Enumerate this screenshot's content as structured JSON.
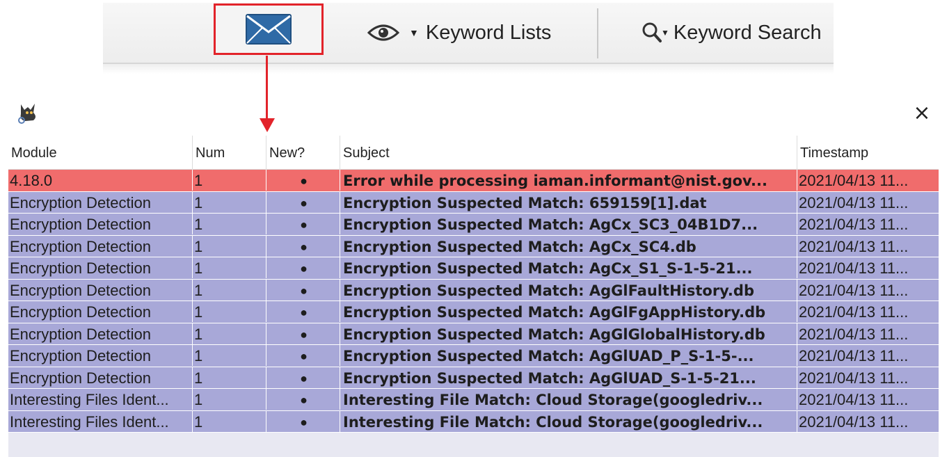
{
  "toolbar": {
    "mail_icon": "envelope-icon",
    "keyword_lists_label": "Keyword Lists",
    "keyword_lists_icon": "eye-icon",
    "keyword_search_label": "Keyword Search",
    "keyword_search_icon": "magnifier-icon",
    "highlight_color": "#e2232a"
  },
  "panel": {
    "app_icon": "autopsy-dog-icon",
    "close_label": "×"
  },
  "table": {
    "headers": {
      "module": "Module",
      "num": "Num",
      "new": "New?",
      "subject": "Subject",
      "timestamp": "Timestamp"
    },
    "rows": [
      {
        "module": "4.18.0",
        "num": "1",
        "new": "●",
        "subject": "Error while processing iaman.informant@nist.gov...",
        "timestamp": "2021/04/13 11...",
        "status": "error"
      },
      {
        "module": "Encryption Detection",
        "num": "1",
        "new": "●",
        "subject": "Encryption Suspected Match: 659159[1].dat",
        "timestamp": "2021/04/13 11...",
        "status": "normal"
      },
      {
        "module": "Encryption Detection",
        "num": "1",
        "new": "●",
        "subject": "Encryption Suspected Match: AgCx_SC3_04B1D7...",
        "timestamp": "2021/04/13 11...",
        "status": "normal"
      },
      {
        "module": "Encryption Detection",
        "num": "1",
        "new": "●",
        "subject": "Encryption Suspected Match: AgCx_SC4.db",
        "timestamp": "2021/04/13 11...",
        "status": "normal"
      },
      {
        "module": "Encryption Detection",
        "num": "1",
        "new": "●",
        "subject": "Encryption Suspected Match: AgCx_S1_S-1-5-21...",
        "timestamp": "2021/04/13 11...",
        "status": "normal"
      },
      {
        "module": "Encryption Detection",
        "num": "1",
        "new": "●",
        "subject": "Encryption Suspected Match: AgGlFaultHistory.db",
        "timestamp": "2021/04/13 11...",
        "status": "normal"
      },
      {
        "module": "Encryption Detection",
        "num": "1",
        "new": "●",
        "subject": "Encryption Suspected Match: AgGlFgAppHistory.db",
        "timestamp": "2021/04/13 11...",
        "status": "normal"
      },
      {
        "module": "Encryption Detection",
        "num": "1",
        "new": "●",
        "subject": "Encryption Suspected Match: AgGlGlobalHistory.db",
        "timestamp": "2021/04/13 11...",
        "status": "normal"
      },
      {
        "module": "Encryption Detection",
        "num": "1",
        "new": "●",
        "subject": "Encryption Suspected Match: AgGlUAD_P_S-1-5-...",
        "timestamp": "2021/04/13 11...",
        "status": "normal"
      },
      {
        "module": "Encryption Detection",
        "num": "1",
        "new": "●",
        "subject": "Encryption Suspected Match: AgGlUAD_S-1-5-21...",
        "timestamp": "2021/04/13 11...",
        "status": "normal"
      },
      {
        "module": "Interesting Files Ident...",
        "num": "1",
        "new": "●",
        "subject": "Interesting File Match: Cloud Storage(googledriv...",
        "timestamp": "2021/04/13 11...",
        "status": "normal"
      },
      {
        "module": "Interesting Files Ident...",
        "num": "1",
        "new": "●",
        "subject": "Interesting File Match: Cloud Storage(googledriv...",
        "timestamp": "2021/04/13 11...",
        "status": "normal"
      }
    ],
    "colors": {
      "error_row": "#f06c6c",
      "normal_row": "#a8a8d8",
      "empty_area": "#e8e8f2"
    }
  }
}
